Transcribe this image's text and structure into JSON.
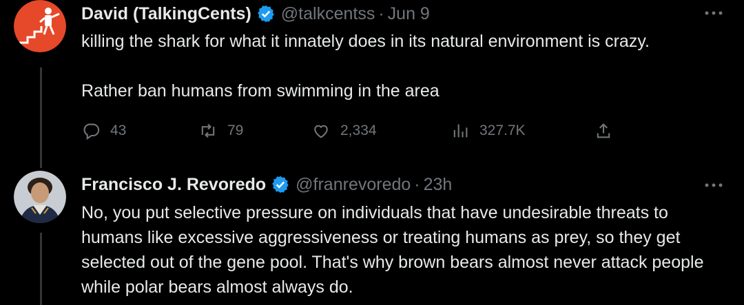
{
  "tweets": [
    {
      "author_name": "David (TalkingCents)",
      "handle": "@talkcentss",
      "separator": "·",
      "time": "Jun 9",
      "text": [
        "killing the shark for what it innately does in its natural environment is crazy.",
        "Rather ban humans from swimming in the area"
      ],
      "stats": {
        "replies": "43",
        "reposts": "79",
        "likes": "2,334",
        "views": "327.7K"
      }
    },
    {
      "author_name": "Francisco J. Revoredo",
      "handle": "@franrevoredo",
      "separator": "·",
      "time": "23h",
      "text": [
        "No, you put selective pressure on individuals that have undesirable threats to humans like excessive aggressiveness or treating humans as prey, so they get selected out of the gene pool. That's why brown bears almost never attack people while polar bears almost always do."
      ]
    }
  ],
  "colors": {
    "background": "#000000",
    "text": "#e7e9ea",
    "secondary": "#71767b",
    "verified": "#1d9bf0",
    "avatar1": "#e5492a"
  },
  "icons": [
    "verified-badge-icon",
    "more-icon",
    "reply-icon",
    "repost-icon",
    "like-icon",
    "views-icon",
    "share-icon"
  ]
}
